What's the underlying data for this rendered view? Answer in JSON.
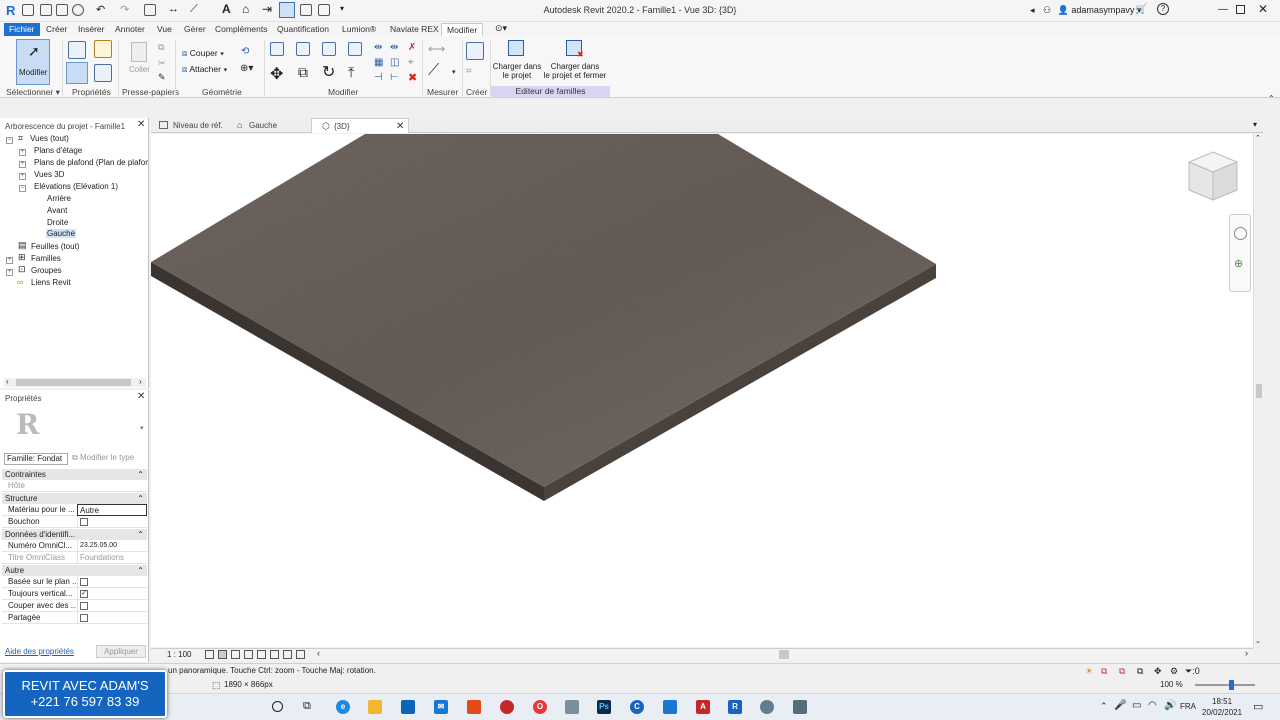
{
  "titlebar": {
    "title": "Autodesk Revit 2020.2 - Famille1 - Vue 3D: {3D}",
    "user": "adamasympavy",
    "app_icon": "R"
  },
  "ribbon_tabs": [
    "Fichier",
    "Créer",
    "Insérer",
    "Annoter",
    "Vue",
    "Gérer",
    "Compléments",
    "Quantification",
    "Lumion®",
    "Naviate REX",
    "Modifier"
  ],
  "ribbon": {
    "modifier_label": "Modifier",
    "couper_label": "Couper",
    "attacher_label": "Attacher",
    "coller_label": "Coller",
    "charger_projet": "Charger dans\nle projet",
    "charger_fermer": "Charger dans\nle projet et fermer",
    "groups": {
      "selectionner": "Sélectionner",
      "proprietes": "Propriétés",
      "presse_papiers": "Presse-papiers",
      "geometrie": "Géométrie",
      "modifier": "Modifier",
      "mesurer": "Mesurer",
      "creer": "Créer",
      "editeur": "Editeur de familles"
    }
  },
  "doc_tabs": [
    {
      "label": "Niveau de réf."
    },
    {
      "label": "Gauche"
    },
    {
      "label": "{3D}"
    }
  ],
  "browser": {
    "title": "Arborescence du projet - Famille1",
    "items": [
      {
        "label": "Vues (tout)"
      },
      {
        "label": "Plans d'étage"
      },
      {
        "label": "Plans de plafond (Plan de plafon"
      },
      {
        "label": "Vues 3D"
      },
      {
        "label": "Elévations (Elévation 1)"
      },
      {
        "label": "Arrière"
      },
      {
        "label": "Avant"
      },
      {
        "label": "Droite"
      },
      {
        "label": "Gauche"
      },
      {
        "label": "Feuilles (tout)"
      },
      {
        "label": "Familles"
      },
      {
        "label": "Groupes"
      },
      {
        "label": "Liens Revit"
      }
    ]
  },
  "properties": {
    "title": "Propriétés",
    "type_selector": "Famille: Fondat",
    "edit_type": "Modifier le type",
    "sections": {
      "contraintes": "Contraintes",
      "structure": "Structure",
      "donnees": "Données d'identifi...",
      "autre": "Autre"
    },
    "rows": {
      "hote_k": "Hôte",
      "hote_v": "",
      "materiau_k": "Matériau pour le ...",
      "materiau_v": "Autre",
      "bouchon_k": "Bouchon",
      "omni_num_k": "Numéro OmniCl...",
      "omni_num_v": "23.25.05.00",
      "omni_title_k": "Titre OmniClass",
      "omni_title_v": "Foundations",
      "base_k": "Basée sur le plan ...",
      "toujours_k": "Toujours vertical...",
      "couper_k": "Couper avec des ...",
      "partagee_k": "Partagée"
    },
    "help_link": "Aide des propriétés",
    "apply": "Appliquer"
  },
  "view_control": {
    "scale": "1 : 100"
  },
  "status": {
    "message": "un panoramique. Touche Ctrl: zoom - Touche Maj: rotation.",
    "dims": "1890 × 866px",
    "zoom": "100 %",
    "filter_count": ":0"
  },
  "promo": {
    "line1": "REVIT AVEC ADAM'S",
    "line2": "+221 76 597 83 39"
  },
  "taskbar": {
    "lang": "FRA",
    "time": "18:51",
    "date": "20/02/2021"
  },
  "colors": {
    "file_tab": "#1d6fd1",
    "editor_group": "#d9d4f3",
    "slab_top": "#6b615b",
    "promo": "#1565c0"
  }
}
